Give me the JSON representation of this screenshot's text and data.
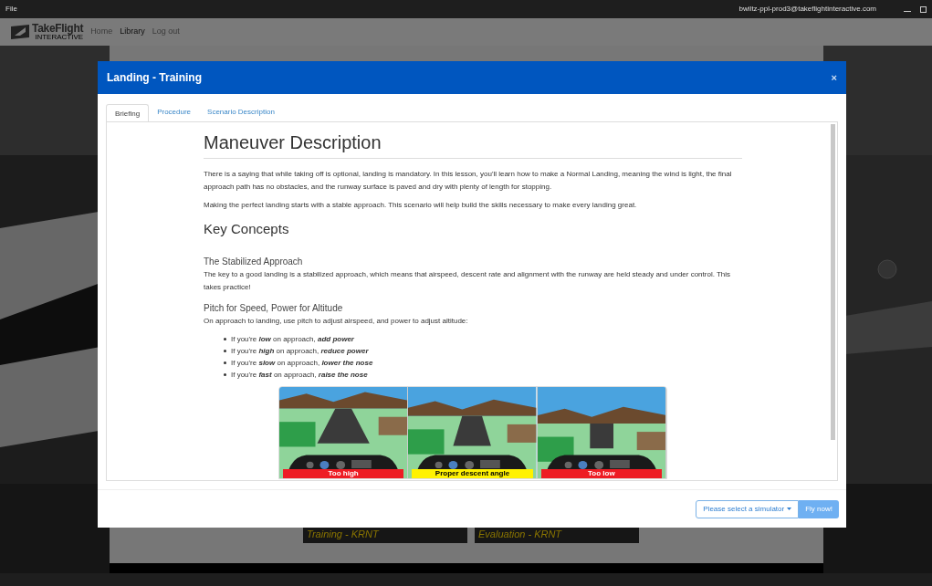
{
  "app_bar": {
    "menu": "File",
    "user": "bwiltz-ppl-prod3@takeflightinteractive.com"
  },
  "nav": {
    "logo": "TakeFlight",
    "logo_sub": "INTERACTIVE",
    "links": [
      {
        "label": "Home",
        "selected": false
      },
      {
        "label": "Library",
        "selected": true
      },
      {
        "label": "Log out",
        "selected": false
      }
    ]
  },
  "background_cards": [
    {
      "title": "Training - KRNT"
    },
    {
      "title": "Evaluation - KRNT"
    }
  ],
  "modal": {
    "title": "Landing - Training",
    "close": "×",
    "tabs": [
      {
        "label": "Briefing",
        "selected": true
      },
      {
        "label": "Procedure",
        "selected": false
      },
      {
        "label": "Scenario Description",
        "selected": false
      }
    ],
    "content": {
      "heading": "Maneuver Description",
      "paragraphs": [
        "There is a saying that while taking off is optional, landing is mandatory. In this lesson, you'll learn how to make a Normal Landing, meaning the wind is light, the final approach path has no obstacles, and the runway surface is paved and dry with plenty of length for stopping.",
        "Making the perfect landing starts with a stable approach. This scenario will help build the skills necessary to make every landing great."
      ],
      "section_heading": "Key Concepts",
      "concepts": [
        {
          "title": "The Stabilized Approach",
          "text": "The key to a good landing is a stabilized approach, which means that airspeed, descent rate and alignment with the runway are held steady and under control. This takes practice!"
        },
        {
          "title": "Pitch for Speed, Power for Altitude",
          "text": "On approach to landing, use pitch to adjust airspeed, and power to adjust altitude:",
          "bullets": [
            "If you're **low** on approach, **add power**",
            "If you're **high** on approach, **reduce power**",
            "If you're **slow** on approach, **lower the nose**",
            "If you're **fast** on approach, **raise the nose**"
          ]
        }
      ],
      "figure": [
        {
          "caption": "Too high",
          "color": "#ee1c24"
        },
        {
          "caption": "Proper descent angle",
          "color": "#fff200"
        },
        {
          "caption": "Too low",
          "color": "#ee1c24"
        }
      ]
    },
    "simulator_dropdown": "Please select a simulator",
    "fly_button": "Fly now!"
  }
}
